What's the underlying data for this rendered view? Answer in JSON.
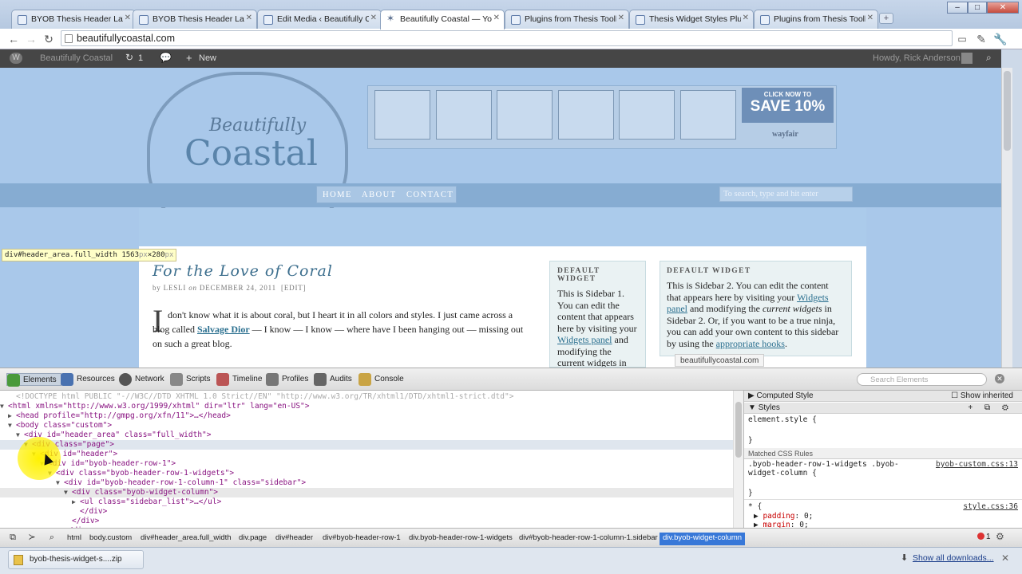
{
  "browser": {
    "tabs": [
      {
        "title": "BYOB Thesis Header Layout"
      },
      {
        "title": "BYOB Thesis Header Layout"
      },
      {
        "title": "Edit Media ‹ Beautifully Coastal"
      },
      {
        "title": "Beautifully Coastal — Your"
      },
      {
        "title": "Plugins from Thesis Toolbox"
      },
      {
        "title": "Thesis Widget Styles Plugin"
      },
      {
        "title": "Plugins from Thesis Toolbox"
      }
    ],
    "active_tab": 3,
    "url": "beautifullycoastal.com",
    "window_buttons": [
      "–",
      "□",
      "✕"
    ]
  },
  "admin_bar": {
    "site_name": "Beautifully Coastal",
    "updates_count": "1",
    "new_label": "New",
    "greeting": "Howdy, Rick Anderson"
  },
  "site": {
    "logo_line1": "Beautifully",
    "logo_line2": "Coastal",
    "ad_click": "CLICK NOW TO",
    "ad_save": "SAVE 10%",
    "ad_brand": "wayfair",
    "nav": [
      "HOME",
      "ABOUT",
      "CONTACT"
    ],
    "search_placeholder": "To search, type and hit enter",
    "element_label": "div#header_area.full_width",
    "element_size_w": "1563",
    "element_size_h": "280",
    "element_size_unit": "px",
    "post_title": "For the Love of Coral",
    "post_by": "by",
    "post_author": "LESLI",
    "post_on": "on",
    "post_date": "DECEMBER 24, 2011",
    "post_edit": "[EDIT]",
    "dropcap": "I",
    "body_1": "don't know what it is about coral, but I heart it in all colors and styles.  I just came across a blog called ",
    "body_link": "Salvage Dior",
    "body_2": " — I know — I know — where have I been hanging out — missing out on such a great blog.",
    "sidebar1_heading": "Default Widget",
    "sidebar1_text": "This is Sidebar 1. You can edit the content that appears here by visiting your ",
    "sidebar1_link": "Widgets panel",
    "sidebar1_text2": " and modifying the current widgets in",
    "sidebar2_heading": "Default Widget",
    "sidebar2_text_a": "This is Sidebar 2. You can edit the content that appears here by visiting your ",
    "sidebar2_link1": "Widgets panel",
    "sidebar2_text_b": " and modifying the ",
    "sidebar2_em": "current widgets",
    "sidebar2_text_c": " in Sidebar 2. Or, if you want to be a true ninja, you can add your own content to this sidebar by using the ",
    "sidebar2_link2": "appropriate hooks",
    "sidebar2_text_d": ".",
    "status_url": "beautifullycoastal.com"
  },
  "devtools": {
    "tabs": [
      "Elements",
      "Resources",
      "Network",
      "Scripts",
      "Timeline",
      "Profiles",
      "Audits",
      "Console"
    ],
    "search_placeholder": "Search Elements",
    "dom_lines": [
      {
        "arrow": "",
        "indent": 1,
        "text": "<!DOCTYPE html PUBLIC \"-//W3C//DTD XHTML 1.0 Strict//EN\" \"http://www.w3.org/TR/xhtml1/DTD/xhtml1-strict.dtd\">"
      },
      {
        "arrow": "▼",
        "indent": 0,
        "text": "<html xmlns=\"http://www.w3.org/1999/xhtml\" dir=\"ltr\" lang=\"en-US\">"
      },
      {
        "arrow": "▶",
        "indent": 1,
        "text": "<head profile=\"http://gmpg.org/xfn/11\">…</head>"
      },
      {
        "arrow": "▼",
        "indent": 1,
        "text": "<body class=\"custom\">"
      },
      {
        "arrow": "▼",
        "indent": 2,
        "text": "<div id=\"header_area\" class=\"full_width\">"
      },
      {
        "arrow": "▼",
        "indent": 3,
        "text": "<div class=\"page\">"
      },
      {
        "arrow": "▼",
        "indent": 4,
        "text": "<div id=\"header\">"
      },
      {
        "arrow": "▼",
        "indent": 5,
        "text": "<div id=\"byob-header-row-1\">"
      },
      {
        "arrow": "▼",
        "indent": 6,
        "text": "<div class=\"byob-header-row-1-widgets\">"
      },
      {
        "arrow": "▼",
        "indent": 7,
        "text": "<div id=\"byob-header-row-1-column-1\" class=\"sidebar\">"
      },
      {
        "arrow": "▼",
        "indent": 8,
        "text": "<div class=\"byob-widget-column\">"
      },
      {
        "arrow": "▶",
        "indent": 9,
        "text": "<ul class=\"sidebar_list\">…</ul>"
      },
      {
        "arrow": "",
        "indent": 9,
        "text": "</div>"
      },
      {
        "arrow": "",
        "indent": 8,
        "text": "</div>"
      },
      {
        "arrow": "",
        "indent": 7,
        "text": "</div>"
      }
    ],
    "styles": {
      "computed_label": "Computed Style",
      "show_inherited": "Show inherited",
      "styles_label": "Styles",
      "element_style": "element.style {",
      "close_brace": "}",
      "matched_label": "Matched CSS Rules",
      "rule1_selector": ".byob-header-row-1-widgets .byob-",
      "rule1_selector2": "widget-column {",
      "rule1_source": "byob-custom.css:13",
      "rule2_selector": "* {",
      "rule2_source": "style.css:36",
      "prop1_name": "padding",
      "prop1_value": " 0;",
      "prop2_name": "margin",
      "prop2_value": " 0;"
    },
    "breadcrumbs": [
      "html",
      "body.custom",
      "div#header_area.full_width",
      "div.page",
      "div#header",
      "div#byob-header-row-1",
      "div.byob-header-row-1-widgets",
      "div#byob-header-row-1-column-1.sidebar",
      "div.byob-widget-column"
    ],
    "error_count": "1"
  },
  "downloads": {
    "item": "byob-thesis-widget-s....zip",
    "show_all": "Show all downloads..."
  }
}
